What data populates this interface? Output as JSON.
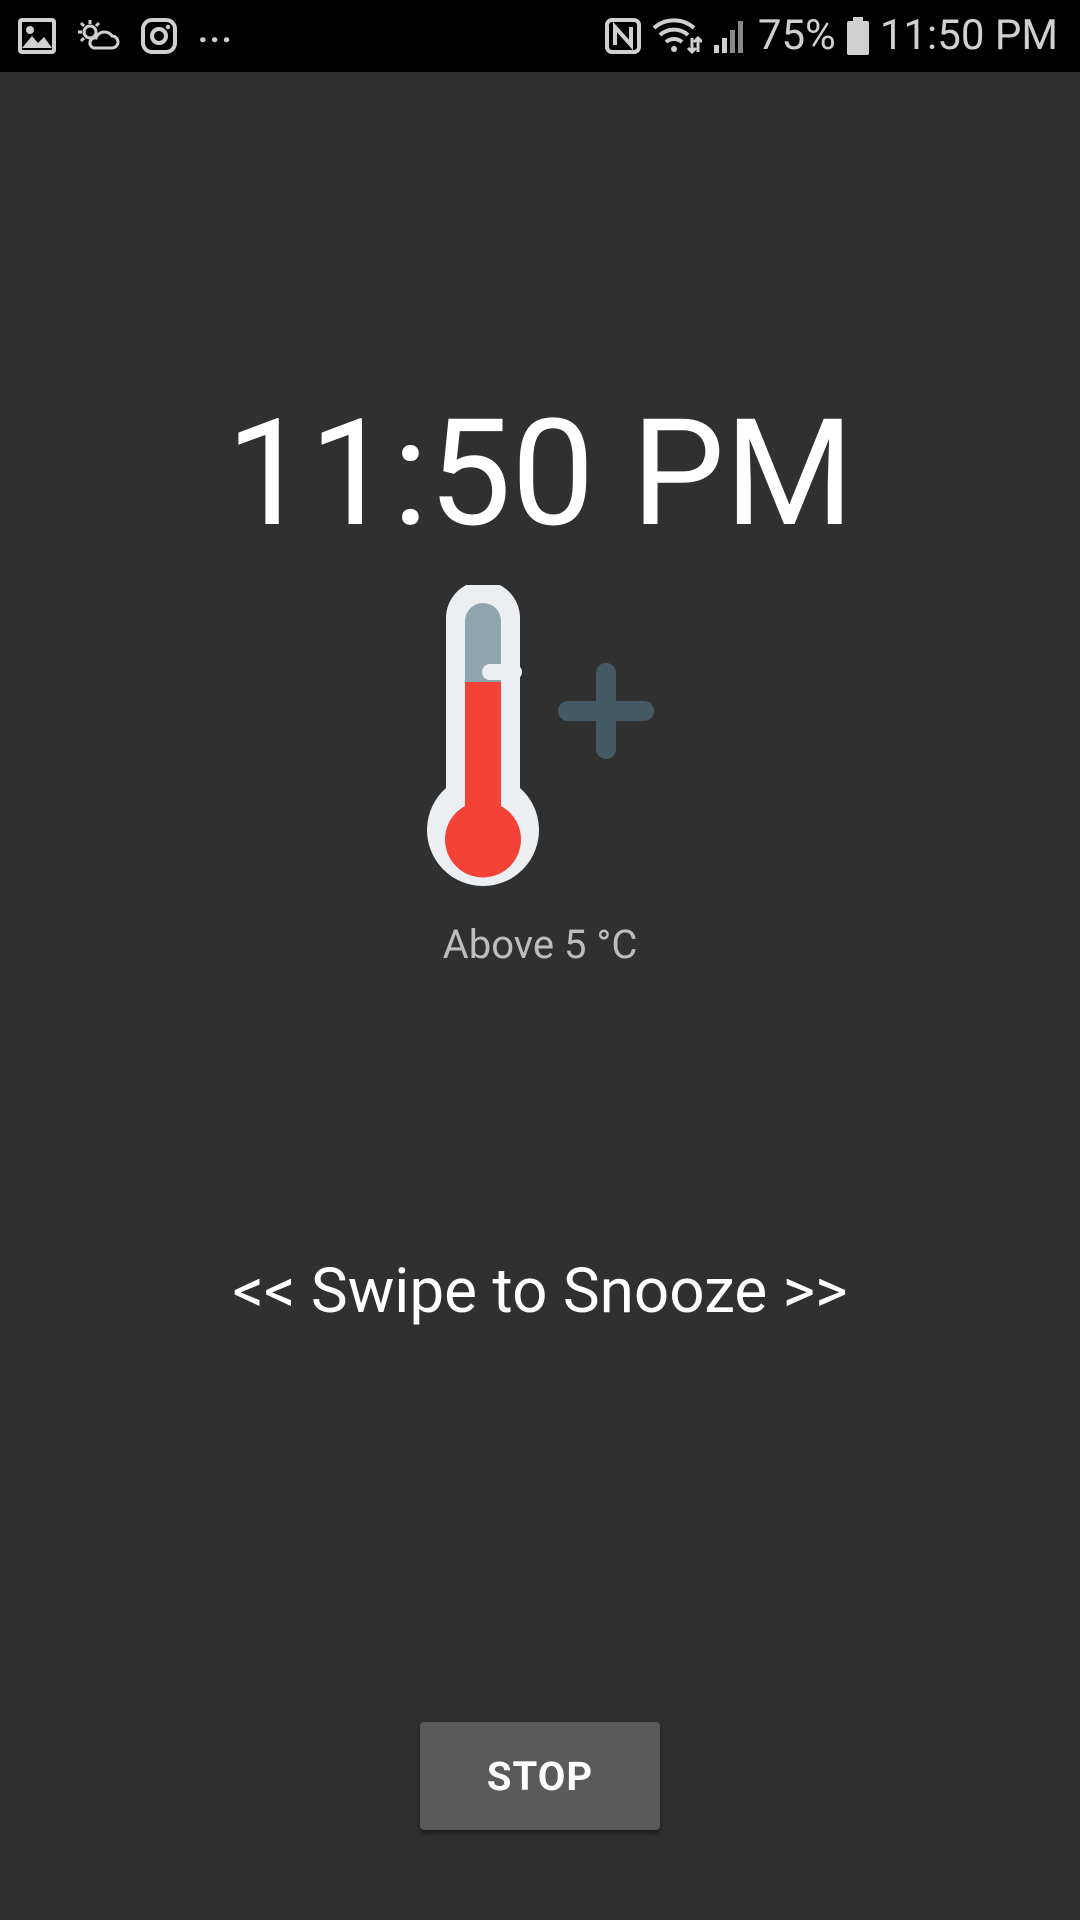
{
  "status_bar": {
    "left_icons": [
      "gallery-icon",
      "weather-icon",
      "instagram-icon"
    ],
    "more_indicator": "...",
    "right_icons": [
      "nfc-icon",
      "wifi-icon",
      "signal-icon",
      "battery-icon"
    ],
    "battery_percent": "75%",
    "clock": "11:50 PM"
  },
  "alarm": {
    "time": "11:50 PM",
    "icon": "thermometer-plus-icon",
    "condition": "Above 5 °C",
    "swipe_hint": "<< Swipe to Snooze >>",
    "stop_label": "STOP"
  },
  "colors": {
    "background": "#303030",
    "status_bar": "#000000",
    "thermometer_outline": "#eceff1",
    "thermometer_mercury": "#f44336",
    "thermometer_empty": "#90a4ae",
    "plus_sign": "#455a64",
    "button": "#5a5a5a"
  }
}
